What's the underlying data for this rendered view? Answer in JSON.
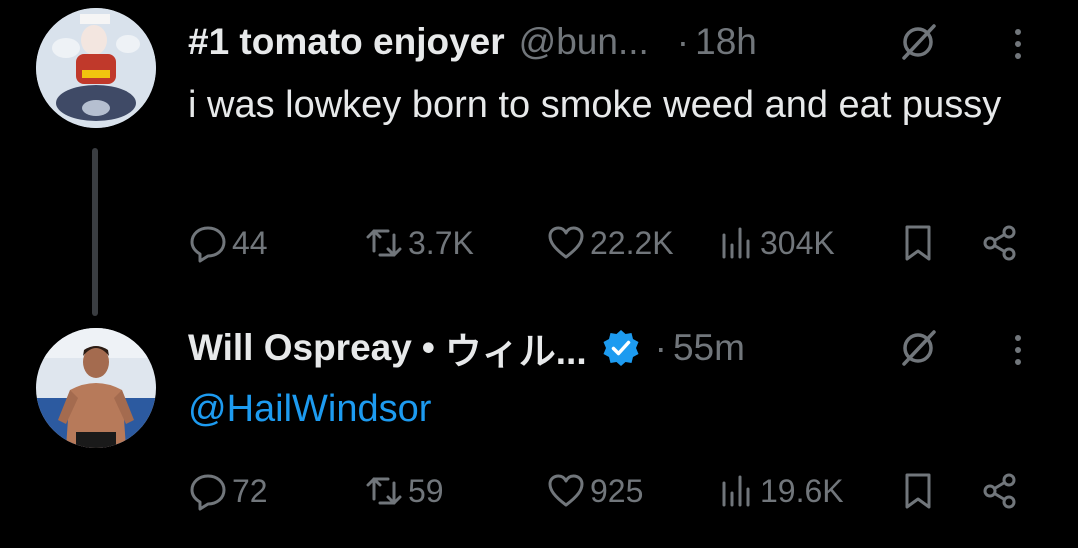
{
  "tweets": [
    {
      "name": "#1 tomato enjoyer",
      "handle": "@bun...",
      "time": "18h",
      "dot": "·",
      "text": "i was lowkey born to smoke weed and eat pussy",
      "stats": {
        "replies": "44",
        "reposts": "3.7K",
        "likes": "22.2K",
        "views": "304K"
      }
    },
    {
      "name": "Will Ospreay",
      "name_sep": "•",
      "name_suffix": "ウィル...",
      "time": "55m",
      "dot": "·",
      "verified": true,
      "mention": "@HailWindsor",
      "stats": {
        "replies": "72",
        "reposts": "59",
        "likes": "925",
        "views": "19.6K"
      }
    }
  ],
  "colors": {
    "background": "#000000",
    "text": "#e7e9ea",
    "muted": "#71767b",
    "accent": "#1d9bf0",
    "thread_line": "#3a3d41"
  },
  "icons": [
    "reply-icon",
    "repost-icon",
    "like-icon",
    "views-icon",
    "bookmark-icon",
    "share-icon",
    "grok-icon",
    "more-icon",
    "verified-badge-icon"
  ]
}
